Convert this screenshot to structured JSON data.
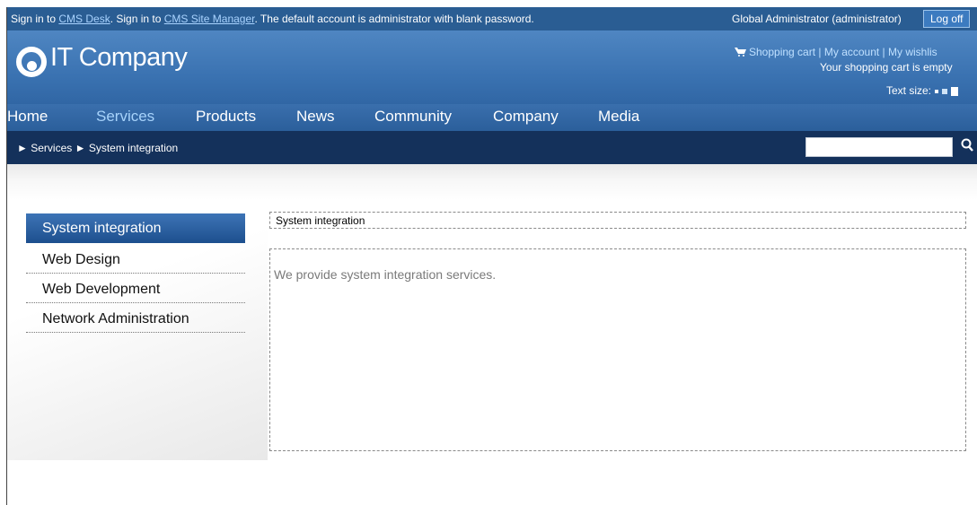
{
  "infobar": {
    "sign_in_prefix": "Sign in to ",
    "cms_desk_link": "CMS Desk",
    "sign_in_middle": ". Sign in to ",
    "site_manager_link": "CMS Site Manager",
    "sign_in_suffix": ". The default account is administrator with blank password.",
    "user": "Global Administrator (administrator)",
    "logoff_label": "Log off"
  },
  "header": {
    "logo_text": "IT Company",
    "cart_link": "Shopping cart",
    "separator": " | ",
    "account_link": "My account",
    "wishlist_link": "My wishlis",
    "cart_status": "Your shopping cart is empty",
    "text_size_label": "Text size:"
  },
  "nav": {
    "items": [
      "Home",
      "Services",
      "Products",
      "News",
      "Community",
      "Company",
      "Media"
    ],
    "active": "Services"
  },
  "breadcrumb": {
    "arrow": "►",
    "items": [
      "Services",
      "System integration"
    ]
  },
  "search": {
    "value": "",
    "icon": "search-icon"
  },
  "sidebar": {
    "items": [
      "System integration",
      "Web Design",
      "Web Development",
      "Network Administration"
    ],
    "active": "System integration"
  },
  "main": {
    "title": "System integration",
    "body": "We provide system integration services."
  },
  "colors": {
    "infobar": "#2a5d93",
    "header": "#3a72b1",
    "crumbbar": "#14315b",
    "nav_active": "#a7d3fb",
    "link": "#a9d3ff"
  }
}
